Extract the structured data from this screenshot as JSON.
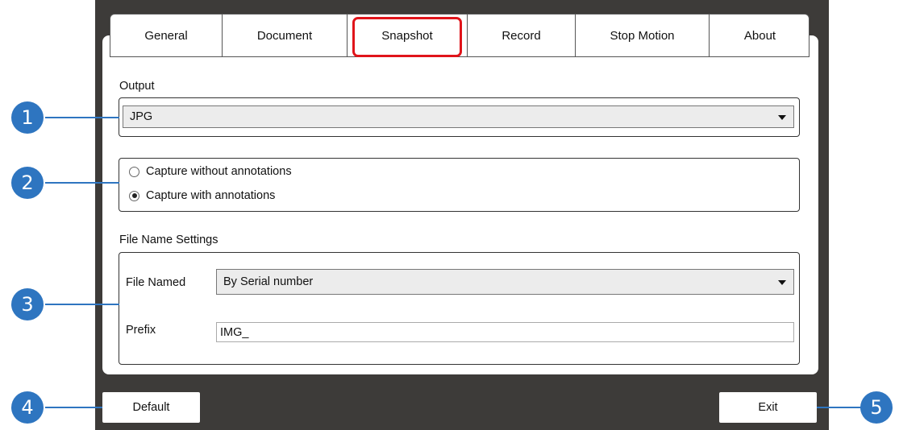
{
  "tabs": [
    {
      "label": "General"
    },
    {
      "label": "Document"
    },
    {
      "label": "Snapshot",
      "active": true
    },
    {
      "label": "Record"
    },
    {
      "label": "Stop Motion"
    },
    {
      "label": "About"
    }
  ],
  "output": {
    "label": "Output",
    "value": "JPG"
  },
  "capture": {
    "option1": "Capture without annotations",
    "option2": "Capture with annotations",
    "selected": "Capture with annotations"
  },
  "file_name": {
    "section_label": "File Name Settings",
    "named_label": "File Named",
    "named_value": "By Serial number",
    "prefix_label": "Prefix",
    "prefix_value": "IMG_"
  },
  "buttons": {
    "default_label": "Default",
    "exit_label": "Exit"
  },
  "callouts": [
    "1",
    "2",
    "3",
    "4",
    "5"
  ],
  "colors": {
    "callout": "#2e75c0",
    "active_tab_highlight": "#e0141a",
    "background": "#3d3b39"
  }
}
